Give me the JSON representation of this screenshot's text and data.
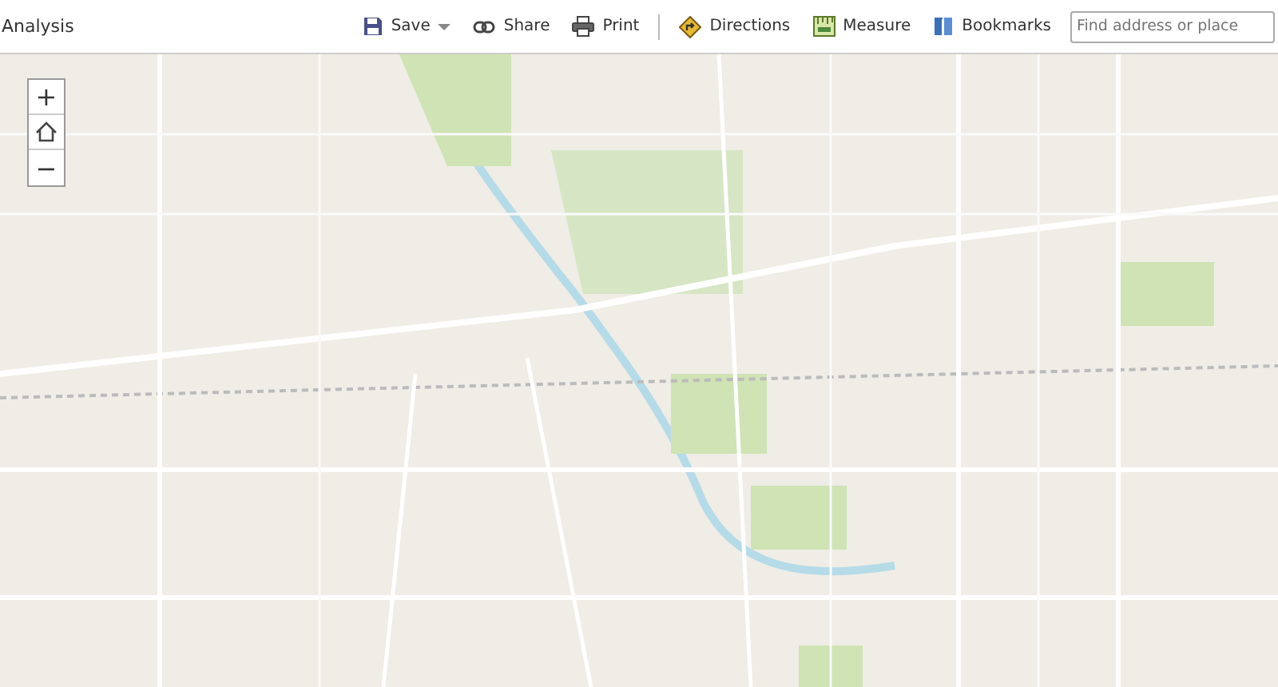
{
  "toolbar": {
    "title": "Analysis",
    "groups": [
      [
        {
          "kind": "save",
          "label": "Save",
          "dropdown": true
        },
        {
          "kind": "share",
          "label": "Share",
          "dropdown": false
        },
        {
          "kind": "print",
          "label": "Print",
          "dropdown": false
        }
      ],
      [
        {
          "kind": "directions",
          "label": "Directions",
          "dropdown": false
        },
        {
          "kind": "measure",
          "label": "Measure",
          "dropdown": false
        },
        {
          "kind": "bookmarks",
          "label": "Bookmarks",
          "dropdown": false
        }
      ]
    ],
    "search": {
      "placeholder": "Find address or place"
    }
  },
  "map_controls": [
    {
      "kind": "zoom_in",
      "label": "+"
    },
    {
      "kind": "home"
    },
    {
      "kind": "zoom_out",
      "label": "−"
    }
  ]
}
